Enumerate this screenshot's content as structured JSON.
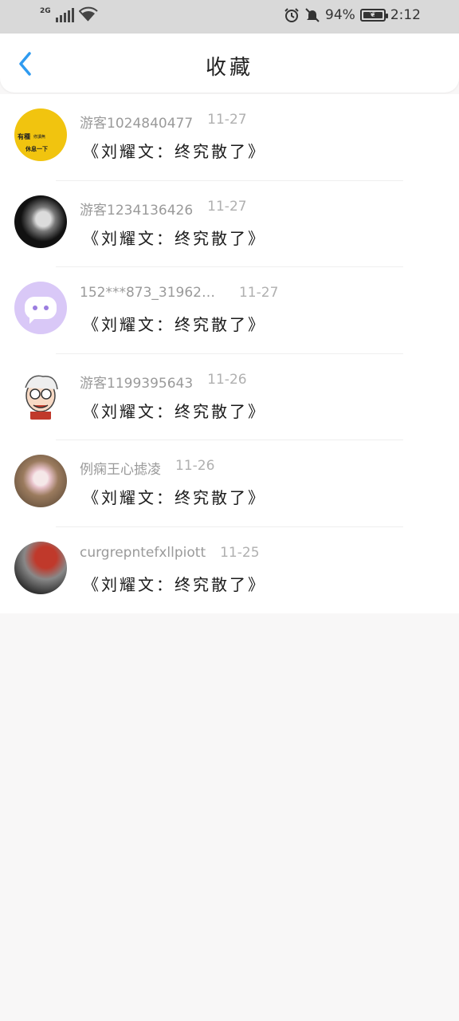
{
  "status_bar": {
    "network": "2G",
    "battery": "94%",
    "time": "2:12"
  },
  "header": {
    "title": "收藏"
  },
  "items": [
    {
      "user": "游客1024840477",
      "date": "11-27",
      "title": "《刘耀文：终究散了》",
      "avatar_text": [
        "有種",
        "修讀無",
        "休息一下"
      ]
    },
    {
      "user": "游客1234136426",
      "date": "11-27",
      "title": "《刘耀文：终究散了》"
    },
    {
      "user": "152***873_31962…",
      "date": "11-27",
      "title": "《刘耀文：终究散了》"
    },
    {
      "user": "游客1199395643",
      "date": "11-26",
      "title": "《刘耀文：终究散了》"
    },
    {
      "user": "例痫王心摅凌",
      "date": "11-26",
      "title": "《刘耀文：终究散了》"
    },
    {
      "user": "curgrepntefxllpiott",
      "date": "11-25",
      "title": "《刘耀文：终究散了》"
    }
  ],
  "colors": {
    "accent": "#2f9bf0",
    "status_bar_bg": "#d9d9d9",
    "page_bg": "#f8f7f7"
  }
}
